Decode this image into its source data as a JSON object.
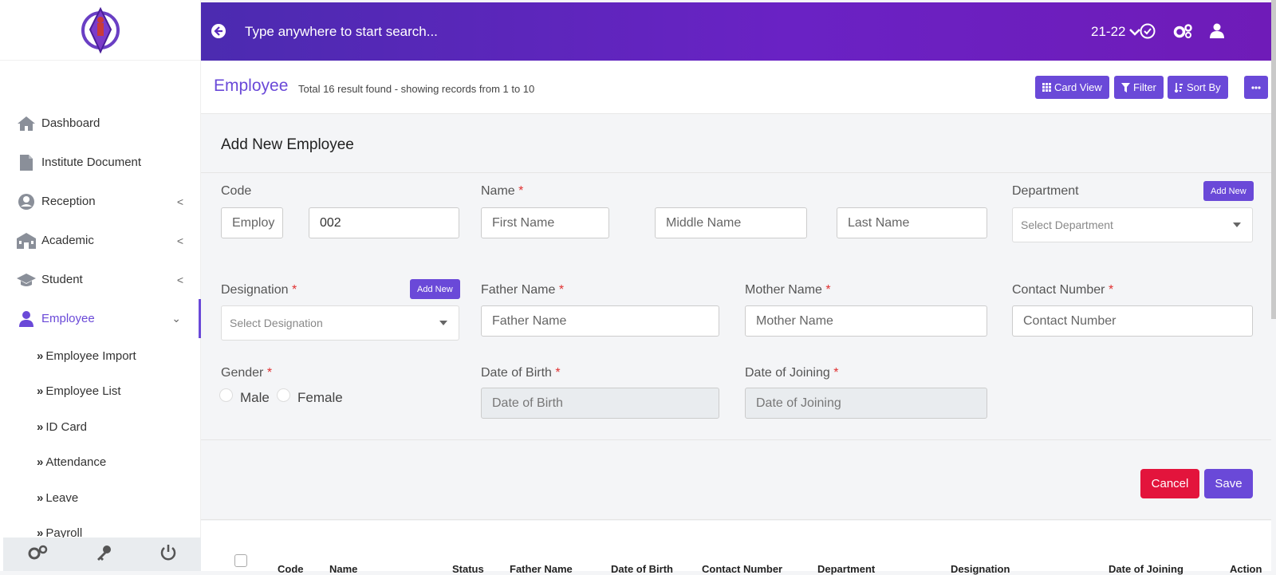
{
  "topbar": {
    "search_placeholder": "Type anywhere to start search...",
    "year": "21-22"
  },
  "sidebar": {
    "items": [
      {
        "label": "Dashboard",
        "icon": "home-icon"
      },
      {
        "label": "Institute Document",
        "icon": "document-icon"
      },
      {
        "label": "Reception",
        "icon": "user-circle-icon"
      },
      {
        "label": "Academic",
        "icon": "school-icon"
      },
      {
        "label": "Student",
        "icon": "graduation-cap-icon"
      },
      {
        "label": "Employee",
        "icon": "employee-icon"
      }
    ],
    "subitems": [
      "Employee Import",
      "Employee List",
      "ID Card",
      "Attendance",
      "Leave",
      "Payroll"
    ],
    "subitem_prefix": "»"
  },
  "header": {
    "title": "Employee",
    "subtitle": "Total 16 result found - showing records from 1 to 10",
    "card_view": "Card View",
    "filter": "Filter",
    "sort_by": "Sort By"
  },
  "form": {
    "title": "Add New Employee",
    "code_label": "Code",
    "code_prefix": "Employ",
    "code_value": "002",
    "name_label": "Name",
    "first_name": "First Name",
    "middle_name": "Middle Name",
    "last_name": "Last Name",
    "department_label": "Department",
    "department_placeholder": "Select Department",
    "add_new": "Add New",
    "designation_label": "Designation",
    "designation_placeholder": "Select Designation",
    "father_label": "Father Name",
    "father_placeholder": "Father Name",
    "mother_label": "Mother Name",
    "mother_placeholder": "Mother Name",
    "contact_label": "Contact Number",
    "contact_placeholder": "Contact Number",
    "gender_label": "Gender",
    "male": "Male",
    "female": "Female",
    "dob_label": "Date of Birth",
    "dob_placeholder": "Date of Birth",
    "doj_label": "Date of Joining",
    "doj_placeholder": "Date of Joining",
    "required_mark": "*",
    "cancel": "Cancel",
    "save": "Save"
  },
  "table": {
    "columns": [
      "Code",
      "Name",
      "Status",
      "Father Name",
      "Date of Birth",
      "Contact Number",
      "Department",
      "Designation",
      "Date of Joining",
      "Action"
    ]
  },
  "colors": {
    "accent": "#6a49d8",
    "danger": "#e3143c",
    "topbar_start": "#4b2bb0",
    "topbar_end": "#6f1bb8"
  }
}
